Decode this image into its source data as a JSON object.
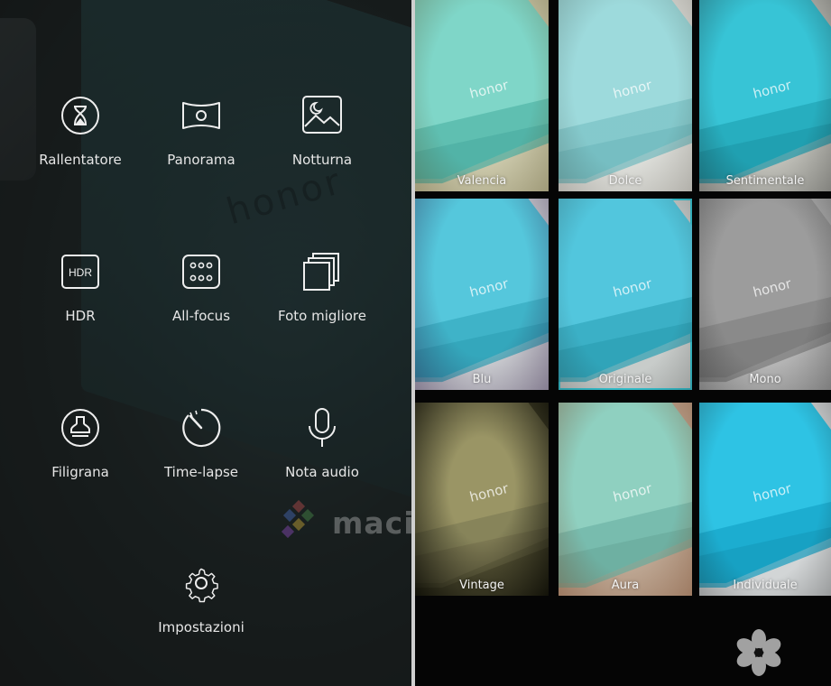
{
  "modes": [
    {
      "label": "Rallentatore",
      "icon": "hourglass-icon"
    },
    {
      "label": "Panorama",
      "icon": "panorama-icon"
    },
    {
      "label": "Notturna",
      "icon": "night-image-icon"
    },
    {
      "label": "HDR",
      "icon": "hdr-icon",
      "icon_text": "HDR"
    },
    {
      "label": "All-focus",
      "icon": "all-focus-icon"
    },
    {
      "label": "Foto migliore",
      "icon": "best-photo-icon"
    },
    {
      "label": "Filigrana",
      "icon": "watermark-stamp-icon"
    },
    {
      "label": "Time-lapse",
      "icon": "timelapse-icon"
    },
    {
      "label": "Nota audio",
      "icon": "microphone-icon"
    },
    {
      "label": "Impostazioni",
      "icon": "gear-icon"
    }
  ],
  "background": {
    "logo_text": "honor"
  },
  "watermark": {
    "text": "macitynet.it"
  },
  "filters": [
    {
      "label": "Valencia",
      "selected": false
    },
    {
      "label": "Dolce",
      "selected": false
    },
    {
      "label": "Sentimentale",
      "selected": false
    },
    {
      "label": "Blu",
      "selected": false
    },
    {
      "label": "Originale",
      "selected": true
    },
    {
      "label": "Mono",
      "selected": false
    },
    {
      "label": "Vintage",
      "selected": false
    },
    {
      "label": "Aura",
      "selected": false
    },
    {
      "label": "Individuale",
      "selected": false
    }
  ],
  "box_logo_text": "honor",
  "colors": {
    "accent": "#35c6d4",
    "text": "#e6e6e6"
  }
}
